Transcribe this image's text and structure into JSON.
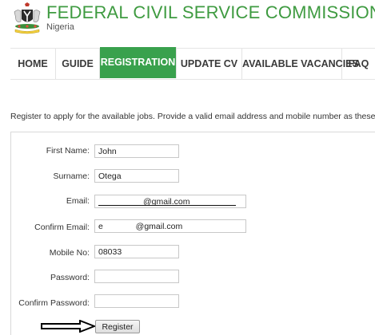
{
  "header": {
    "title": "FEDERAL CIVIL SERVICE COMMISSION",
    "country": "Nigeria",
    "logo_icon": "coat-of-arms-icon"
  },
  "nav": {
    "items": [
      {
        "label": "HOME",
        "active": false
      },
      {
        "label": "GUIDE",
        "active": false
      },
      {
        "label": "REGISTRATION",
        "active": true
      },
      {
        "label": "UPDATE CV",
        "active": false
      },
      {
        "label": "AVAILABLE VACANCIES",
        "active": false
      },
      {
        "label": "FAQ",
        "active": false
      }
    ]
  },
  "intro": "Register to apply for the available jobs. Provide a valid email address and mobile number as these will b",
  "form": {
    "fields": [
      {
        "label": "First Name:",
        "value": "John"
      },
      {
        "label": "Surname:",
        "value": "Otega"
      },
      {
        "label": "Email:",
        "value": "@gmail.com"
      },
      {
        "label": "Confirm Email:",
        "value": "e              @gmail.com"
      },
      {
        "label": "Mobile No:",
        "value": "08033"
      },
      {
        "label": "Password:",
        "value": ""
      },
      {
        "label": "Confirm Password:",
        "value": ""
      }
    ],
    "submit_label": "Register"
  },
  "colors": {
    "brand_green": "#3f9b41",
    "nav_active": "#39a14d"
  }
}
